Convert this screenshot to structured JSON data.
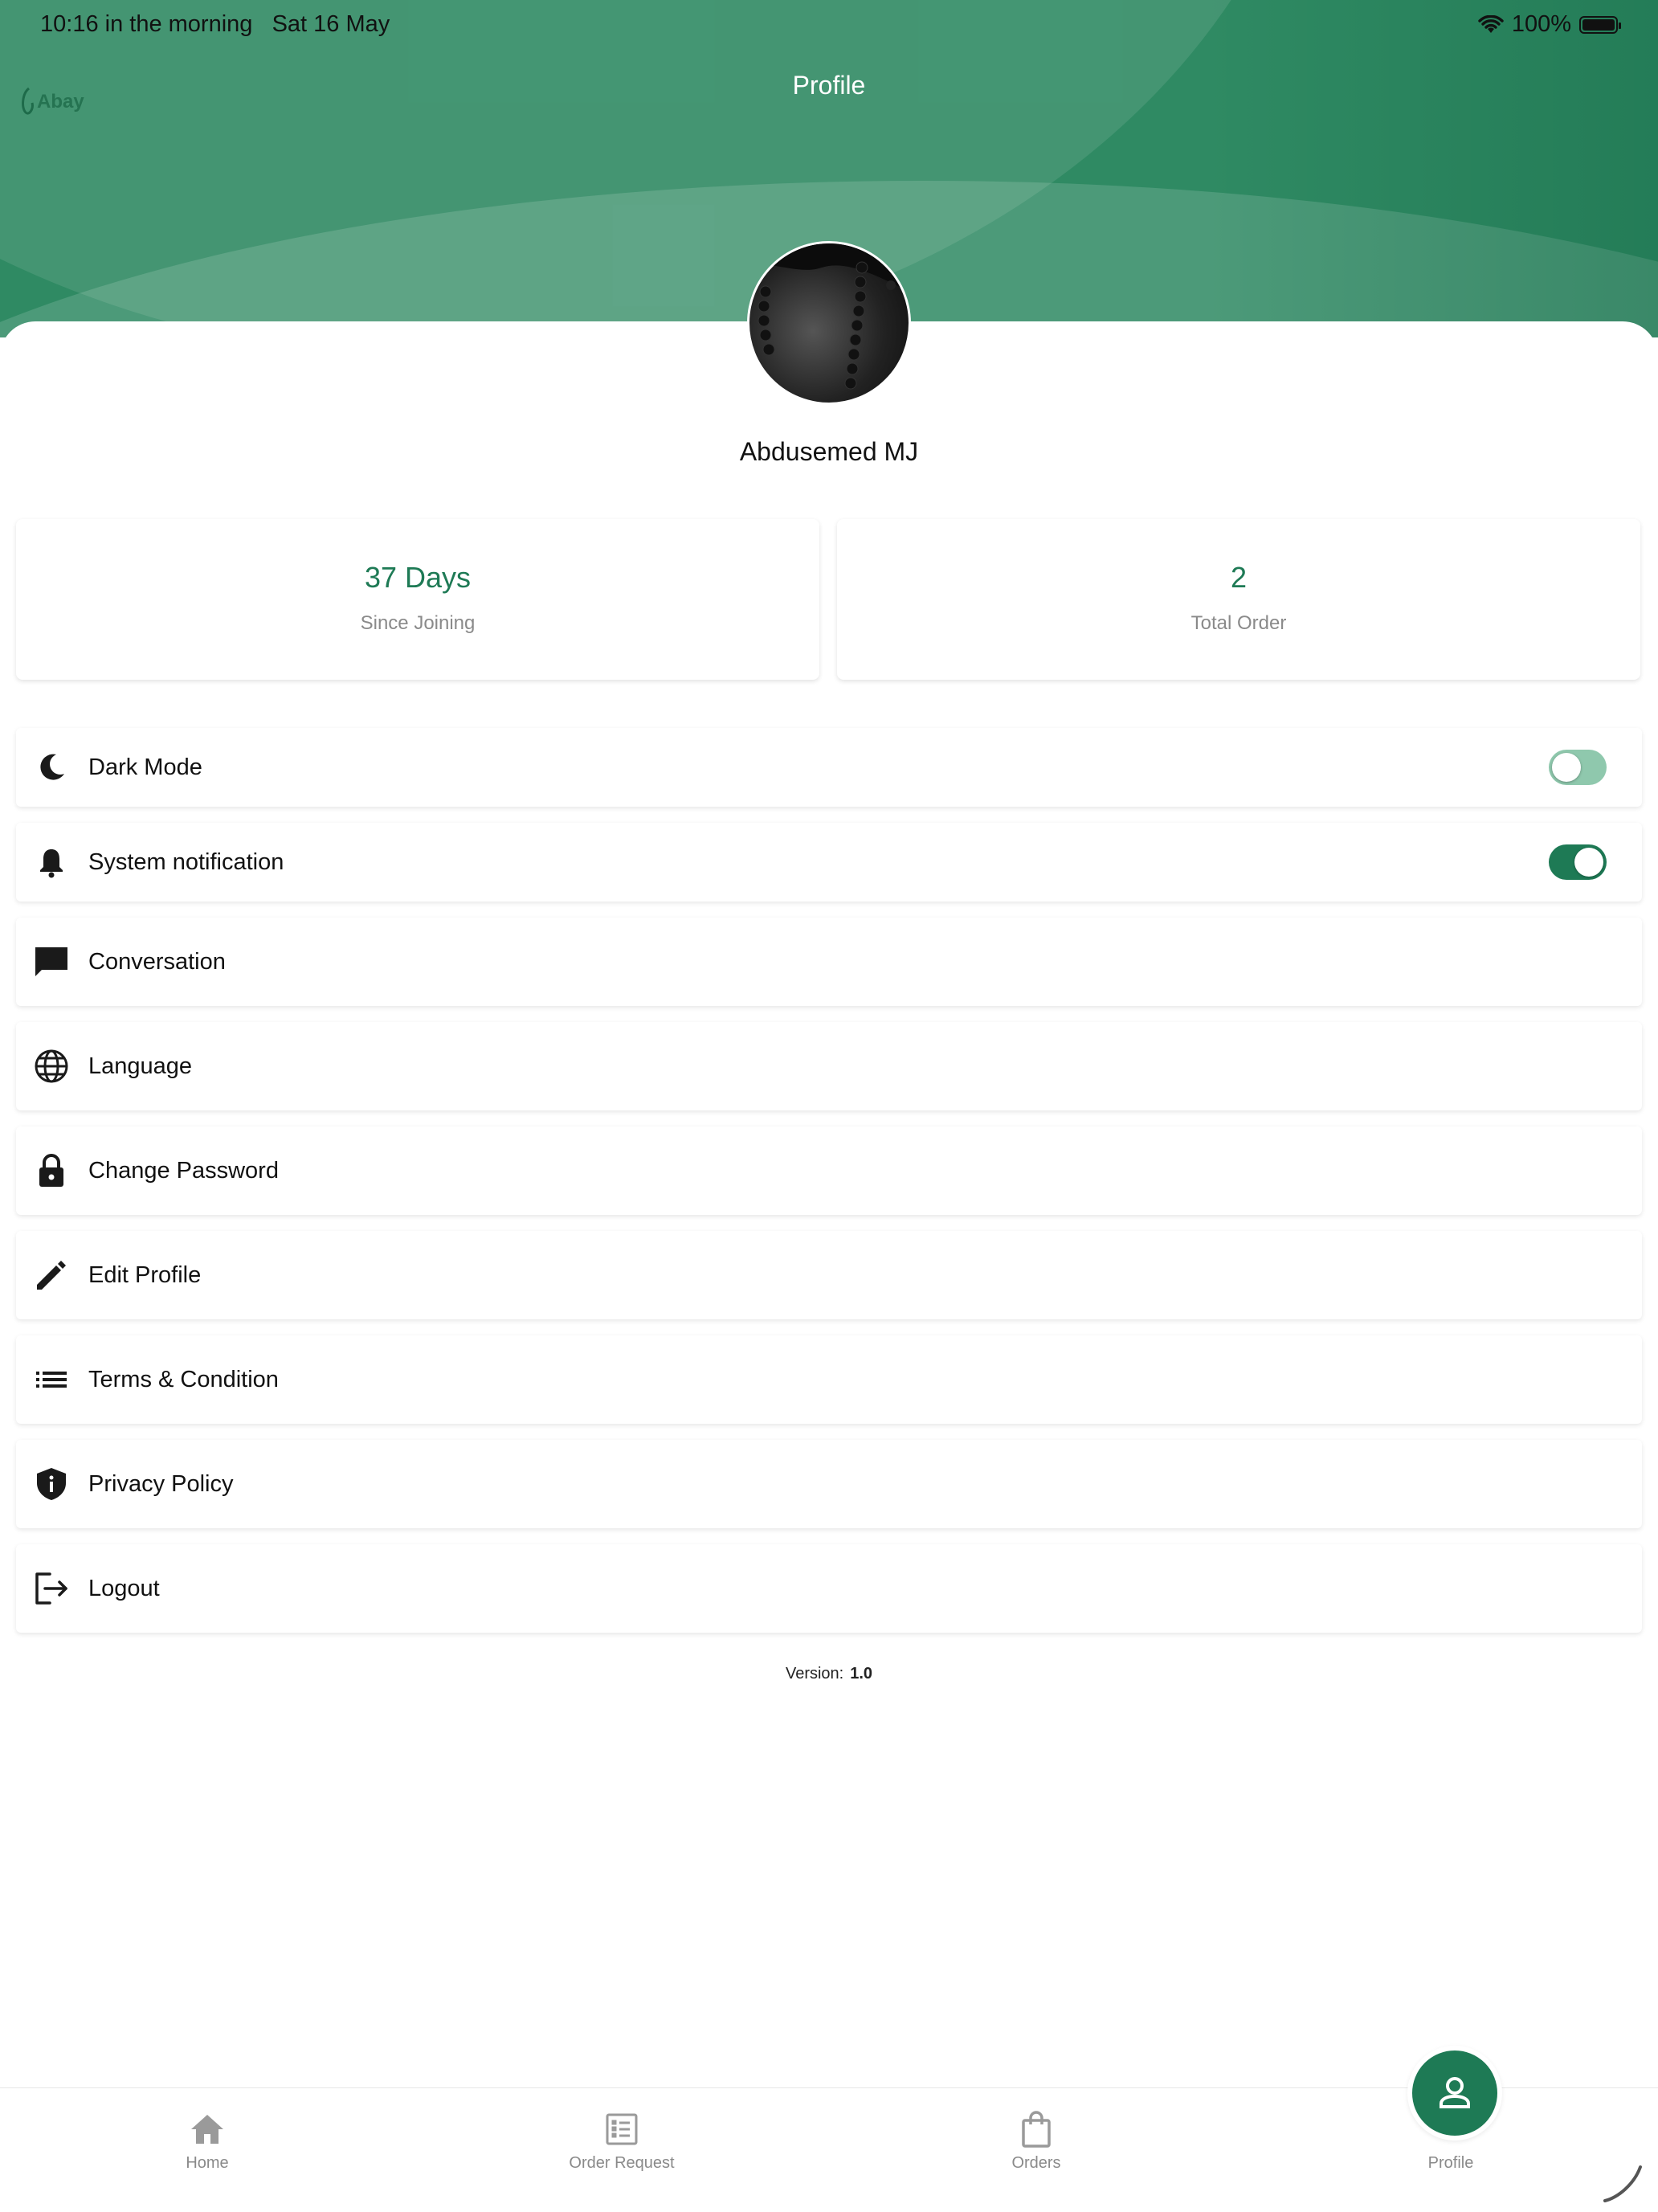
{
  "status_bar": {
    "time": "10:16 in the morning",
    "date": "Sat 16 May",
    "battery": "100%"
  },
  "header": {
    "title": "Profile",
    "logo_text": "Abay"
  },
  "profile": {
    "name": "Abdusemed MJ"
  },
  "stats": [
    {
      "value": "37 Days",
      "label": "Since Joining"
    },
    {
      "value": "2",
      "label": "Total Order"
    }
  ],
  "menu": [
    {
      "label": "Dark Mode",
      "icon": "moon-icon",
      "toggle": false
    },
    {
      "label": "System notification",
      "icon": "bell-icon",
      "toggle": true
    },
    {
      "label": "Conversation",
      "icon": "chat-icon"
    },
    {
      "label": "Language",
      "icon": "globe-icon"
    },
    {
      "label": "Change Password",
      "icon": "lock-icon"
    },
    {
      "label": "Edit Profile",
      "icon": "pencil-icon"
    },
    {
      "label": "Terms & Condition",
      "icon": "list-icon"
    },
    {
      "label": "Privacy Policy",
      "icon": "shield-info-icon"
    },
    {
      "label": "Logout",
      "icon": "logout-icon"
    }
  ],
  "version": {
    "label": "Version:",
    "value": "1.0"
  },
  "tabbar": [
    {
      "label": "Home",
      "icon": "home-icon"
    },
    {
      "label": "Order Request",
      "icon": "list-alt-icon"
    },
    {
      "label": "Orders",
      "icon": "shopping-bag-icon"
    },
    {
      "label": "Profile",
      "icon": "person-icon",
      "active": true
    }
  ],
  "colors": {
    "primary": "#1e7a55",
    "header": "#2f8a63",
    "toggle_off": "#8fc8ad",
    "muted": "#8a8a8a"
  }
}
